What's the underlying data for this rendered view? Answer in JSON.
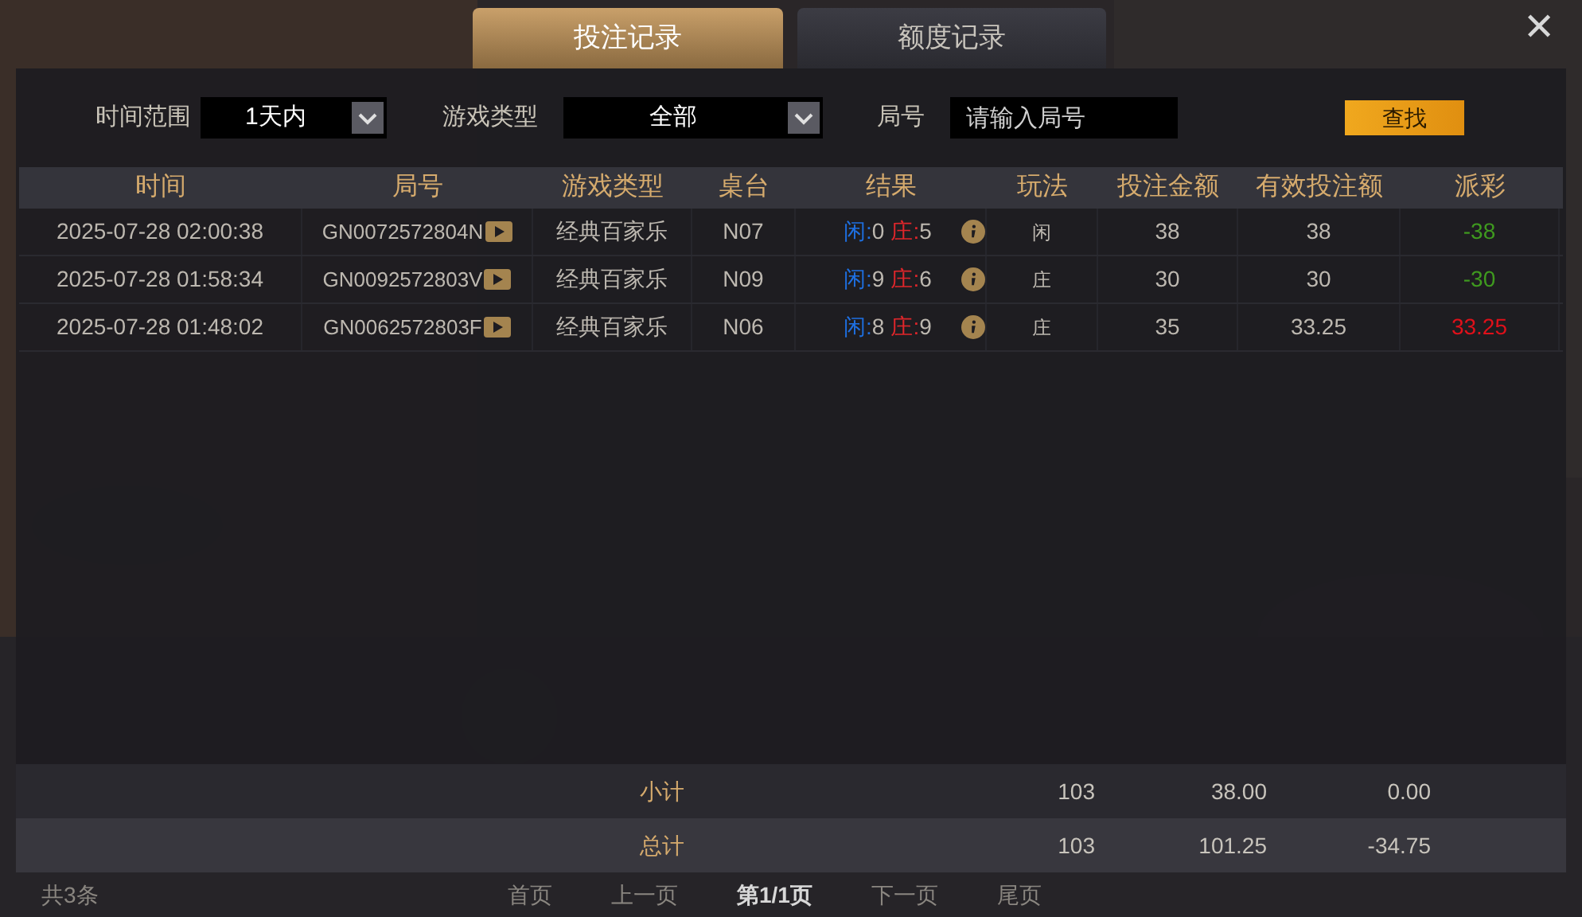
{
  "tabs": [
    {
      "label": "投注记录",
      "selected": true
    },
    {
      "label": "额度记录",
      "selected": false
    }
  ],
  "close": "✕",
  "filters": {
    "time_label": "时间范围",
    "time_value": "1天内",
    "game_label": "游戏类型",
    "game_value": "全部",
    "round_label": "局号",
    "round_placeholder": "请输入局号",
    "search_button": "查找"
  },
  "table": {
    "columns": [
      "时间",
      "局号",
      "游戏类型",
      "桌台",
      "结果",
      "玩法",
      "投注金额",
      "有效投注额",
      "派彩"
    ],
    "rows": [
      {
        "time": "2025-07-28 02:00:38",
        "round": "GN0072572804N",
        "game": "经典百家乐",
        "table": "N07",
        "result": [
          {
            "label": "闲:",
            "value": "0",
            "color": "#1e6fe0"
          },
          {
            "label": "庄:",
            "value": "5",
            "color": "#e0262b"
          }
        ],
        "play": "闲",
        "bet": "38",
        "valid": "38",
        "payout": {
          "text": "-38",
          "color": "#3f9a1f"
        }
      },
      {
        "time": "2025-07-28 01:58:34",
        "round": "GN0092572803V",
        "game": "经典百家乐",
        "table": "N09",
        "result": [
          {
            "label": "闲:",
            "value": "9",
            "color": "#1e6fe0"
          },
          {
            "label": "庄:",
            "value": "6",
            "color": "#e0262b"
          }
        ],
        "play": "庄",
        "bet": "30",
        "valid": "30",
        "payout": {
          "text": "-30",
          "color": "#3f9a1f"
        }
      },
      {
        "time": "2025-07-28 01:48:02",
        "round": "GN0062572803F",
        "game": "经典百家乐",
        "table": "N06",
        "result": [
          {
            "label": "闲:",
            "value": "8",
            "color": "#1e6fe0"
          },
          {
            "label": "庄:",
            "value": "9",
            "color": "#e0262b"
          }
        ],
        "play": "庄",
        "bet": "35",
        "valid": "33.25",
        "payout": {
          "text": "33.25",
          "color": "#e0101a"
        }
      }
    ]
  },
  "summary": [
    {
      "label": "小计",
      "bet": "103",
      "valid": "38.00",
      "payout": "0.00"
    },
    {
      "label": "总计",
      "bet": "103",
      "valid": "101.25",
      "payout": "-34.75"
    }
  ],
  "pagination": {
    "count": "共3条",
    "first": "首页",
    "prev": "上一页",
    "current": "第1/1页",
    "next": "下一页",
    "last": "尾页"
  }
}
